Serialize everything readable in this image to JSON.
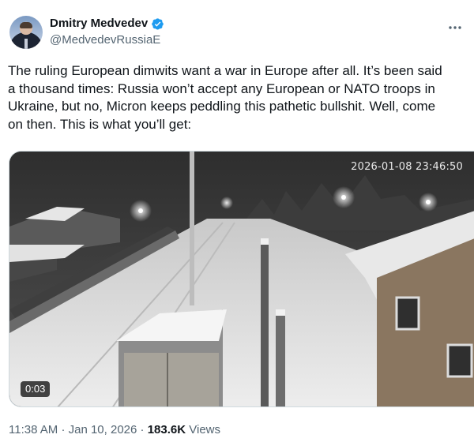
{
  "tweet": {
    "author_name": "Dmitry Medvedev",
    "author_handle": "@MedvedevRussiaE",
    "text": "The ruling European dimwits want a war in Europe after all. It’s been said\na thousand times: Russia won’t accept any European or NATO troops in\nUkraine, but no, Micron keeps peddling this pathetic bullshit. Well, come\non then. This is what you’ll get:",
    "video": {
      "timestamp_overlay": "2026-01-08 23:46:50",
      "duration": "0:03"
    },
    "meta": {
      "time": "11:38 AM",
      "separator": "·",
      "date": "Jan 10, 2026",
      "views_count": "183.6K",
      "views_label": "Views"
    }
  },
  "icons": {
    "verified": "verified-badge-icon",
    "more": "more-options-icon"
  },
  "colors": {
    "verified": "#1d9bf0",
    "text": "#0f1419",
    "secondary": "#536471"
  }
}
